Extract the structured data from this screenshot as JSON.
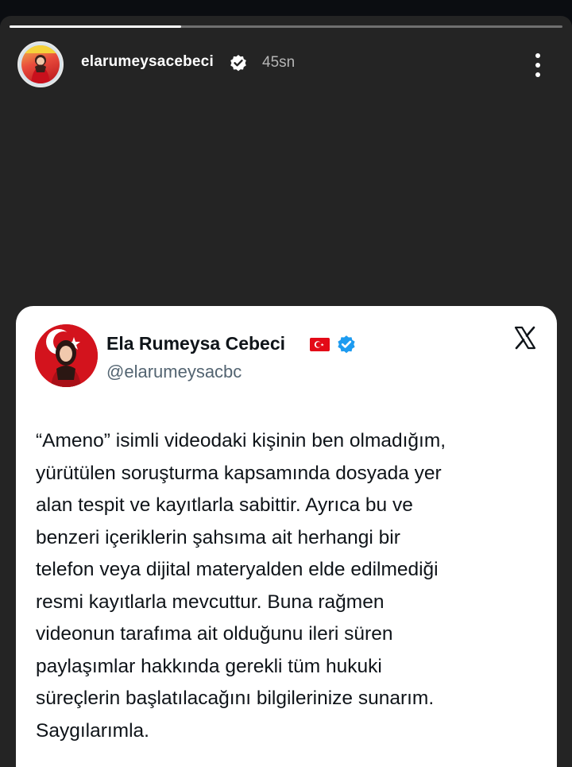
{
  "story": {
    "progress": 0.31,
    "username": "elarumeysacebeci",
    "time": "45sn"
  },
  "post": {
    "display_name": "Ela Rumeysa Cebeci",
    "handle": "@elarumeysacbc",
    "text": "“Ameno” isimli videodaki kişinin ben olmadığım,\nyürütülen soruşturma kapsamında dosyada yer\nalan tespit ve kayıtlarla sabittir. Ayrıca bu ve\nbenzeri içeriklerin şahsıma ait herhangi bir\ntelefon veya dijital materyalden elde edilmediği\nresmi kayıtlarla mevcuttur. Buna rağmen\nvideonun tarafıma ait olduğunu ileri süren\npaylaşımlar hakkında gerekli tüm hukuki\nsüreçlerin başlatılacağını bilgilerinize sunarım.\nSaygılarımla."
  },
  "colors": {
    "story_bg": "#242424",
    "verified_blue": "#1d9bf0",
    "turkey_red": "#e30a17"
  },
  "icons": {
    "header_badge": "verified-badge-icon",
    "menu": "more-vertical-icon",
    "post_flag": "turkey-flag-icon",
    "post_badge": "blue-check-icon",
    "platform": "x-logo-icon"
  }
}
